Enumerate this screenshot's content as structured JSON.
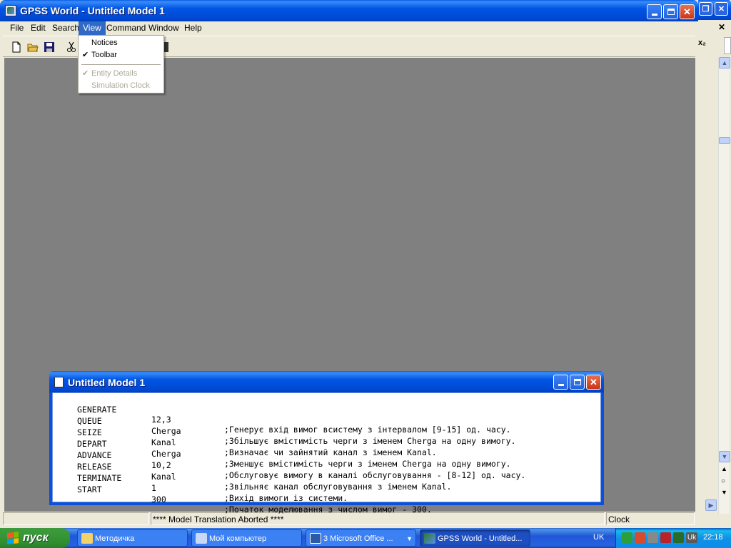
{
  "app": {
    "title": "GPSS World - Untitled Model 1",
    "menu": [
      "File",
      "Edit",
      "Search",
      "View",
      "Command",
      "Window",
      "Help"
    ],
    "active_menu": "View"
  },
  "view_menu": {
    "items": [
      {
        "label": "Notices",
        "checked": false,
        "enabled": true
      },
      {
        "label": "Toolbar",
        "checked": true,
        "enabled": true
      },
      {
        "label": "Entity Details",
        "checked": true,
        "enabled": false
      },
      {
        "label": "Simulation Clock",
        "checked": false,
        "enabled": false
      }
    ]
  },
  "toolbar": {
    "buttons": [
      "new-icon",
      "open-icon",
      "save-icon",
      "cut-icon"
    ]
  },
  "model_window": {
    "title": "Untitled Model 1",
    "lines": [
      {
        "op": "GENERATE",
        "arg": "12,3",
        "comment": ";Генерує вхід вимог всистему з інтервалом [9-15] од. часу."
      },
      {
        "op": "QUEUE",
        "arg": "Cherga",
        "comment": ";Збільшує вмістимість черги з іменем Cherga на одну вимогу."
      },
      {
        "op": "SEIZE",
        "arg": "Kanal",
        "comment": ";Визначає чи зайнятий канал з іменем Kanal."
      },
      {
        "op": "DEPART",
        "arg": "Cherga",
        "comment": ";Зменшує вмістимість черги з іменем Cherga на одну вимогу."
      },
      {
        "op": "ADVANCE",
        "arg": "10,2",
        "comment": ";Обслуговує вимогу в каналі обслуговування - [8-12] од. часу."
      },
      {
        "op": "RELEASE",
        "arg": "Kanal",
        "comment": ";Звільняє канал обслуговування з іменем Kanal."
      },
      {
        "op": "TERMINATE",
        "arg": "1",
        "comment": ";Вихід вимоги із системи."
      },
      {
        "op": "START",
        "arg": "300",
        "comment": ";Початок моделювання з числом вимог - 300."
      }
    ]
  },
  "statusbar": {
    "message": "**** Model Translation Aborted ****",
    "clock_label": "Clock"
  },
  "taskbar": {
    "start_label": "пуск",
    "tasks": [
      {
        "label": "Методичка",
        "icon": "folder-icon",
        "active": false
      },
      {
        "label": "Мой компьютер",
        "icon": "computer-icon",
        "active": false
      },
      {
        "label": "3 Microsoft Office ...",
        "icon": "word-icon",
        "active": false
      },
      {
        "label": "GPSS World - Untitled...",
        "icon": "gpss-icon",
        "active": true
      }
    ],
    "language": "UK",
    "tray_lang": "Uk",
    "clock": "22:18"
  },
  "colors": {
    "xp_blue": "#0055e5",
    "menu_highlight": "#316ac5",
    "mdi_background": "#808080",
    "start_green": "#3a9a3a"
  }
}
